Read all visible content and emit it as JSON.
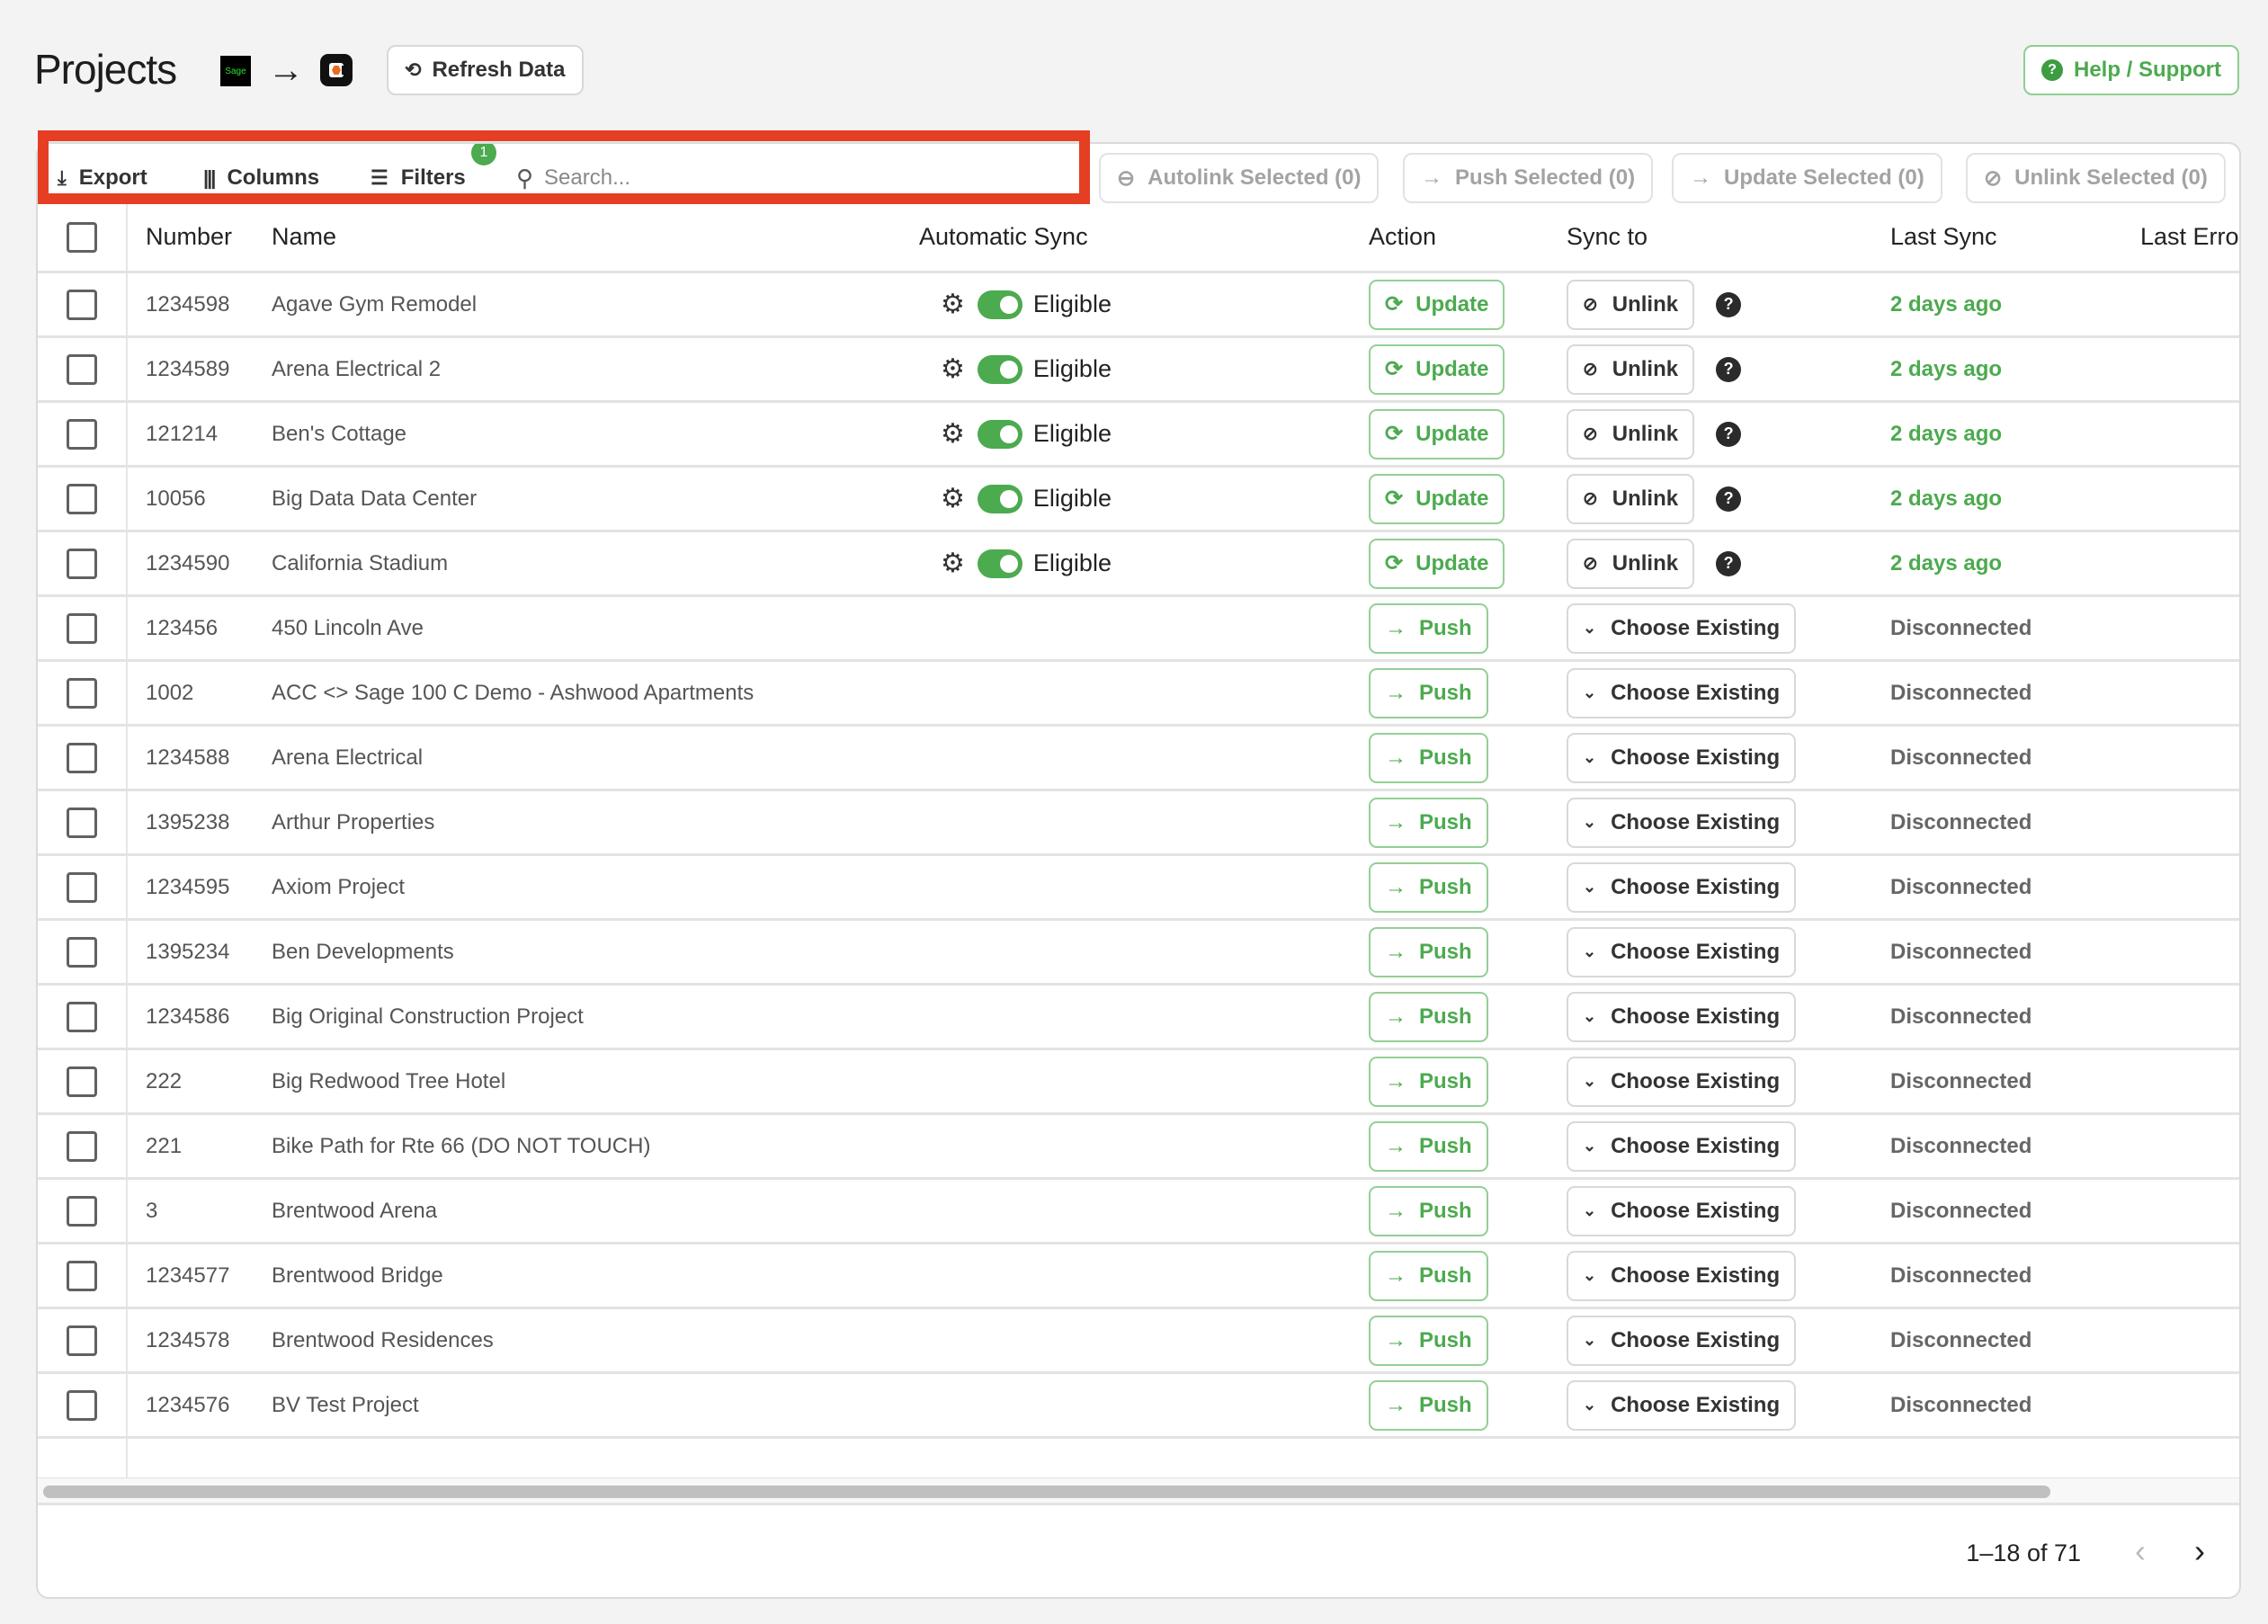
{
  "header": {
    "title": "Projects",
    "source_logo": "Sage",
    "flow_icon": "arrow-right-icon",
    "refresh_label": "Refresh Data",
    "help_label": "Help / Support"
  },
  "toolbar": {
    "export_label": "Export",
    "columns_label": "Columns",
    "filters_label": "Filters",
    "filters_badge": "1",
    "search_placeholder": "Search...",
    "search_value": ""
  },
  "bulk_actions": {
    "autolink": "Autolink Selected (0)",
    "push": "Push Selected (0)",
    "update": "Update Selected (0)",
    "unlink": "Unlink Selected (0)"
  },
  "columns": {
    "number": "Number",
    "name": "Name",
    "auto_sync": "Automatic Sync",
    "action": "Action",
    "sync_to": "Sync to",
    "last_sync": "Last Sync",
    "last_error": "Last Erro"
  },
  "rows": [
    {
      "number": "1234598",
      "name": "Agave Gym Remodel",
      "auto": "Eligible",
      "action": "Update",
      "sync": "Unlink",
      "last": "2 days ago"
    },
    {
      "number": "1234589",
      "name": "Arena Electrical 2",
      "auto": "Eligible",
      "action": "Update",
      "sync": "Unlink",
      "last": "2 days ago"
    },
    {
      "number": "121214",
      "name": "Ben's Cottage",
      "auto": "Eligible",
      "action": "Update",
      "sync": "Unlink",
      "last": "2 days ago"
    },
    {
      "number": "10056",
      "name": "Big Data Data Center",
      "auto": "Eligible",
      "action": "Update",
      "sync": "Unlink",
      "last": "2 days ago"
    },
    {
      "number": "1234590",
      "name": "California Stadium",
      "auto": "Eligible",
      "action": "Update",
      "sync": "Unlink",
      "last": "2 days ago"
    },
    {
      "number": "123456",
      "name": "450 Lincoln Ave",
      "auto": "",
      "action": "Push",
      "sync": "Choose Existing",
      "last": "Disconnected"
    },
    {
      "number": "1002",
      "name": "ACC <> Sage 100 C Demo - Ashwood Apartments",
      "auto": "",
      "action": "Push",
      "sync": "Choose Existing",
      "last": "Disconnected"
    },
    {
      "number": "1234588",
      "name": "Arena Electrical",
      "auto": "",
      "action": "Push",
      "sync": "Choose Existing",
      "last": "Disconnected"
    },
    {
      "number": "1395238",
      "name": "Arthur Properties",
      "auto": "",
      "action": "Push",
      "sync": "Choose Existing",
      "last": "Disconnected"
    },
    {
      "number": "1234595",
      "name": "Axiom Project",
      "auto": "",
      "action": "Push",
      "sync": "Choose Existing",
      "last": "Disconnected"
    },
    {
      "number": "1395234",
      "name": "Ben Developments",
      "auto": "",
      "action": "Push",
      "sync": "Choose Existing",
      "last": "Disconnected"
    },
    {
      "number": "1234586",
      "name": "Big Original Construction Project",
      "auto": "",
      "action": "Push",
      "sync": "Choose Existing",
      "last": "Disconnected"
    },
    {
      "number": "222",
      "name": "Big Redwood Tree Hotel",
      "auto": "",
      "action": "Push",
      "sync": "Choose Existing",
      "last": "Disconnected"
    },
    {
      "number": "221",
      "name": "Bike Path for Rte 66 (DO NOT TOUCH)",
      "auto": "",
      "action": "Push",
      "sync": "Choose Existing",
      "last": "Disconnected"
    },
    {
      "number": "3",
      "name": "Brentwood Arena",
      "auto": "",
      "action": "Push",
      "sync": "Choose Existing",
      "last": "Disconnected"
    },
    {
      "number": "1234577",
      "name": "Brentwood Bridge",
      "auto": "",
      "action": "Push",
      "sync": "Choose Existing",
      "last": "Disconnected"
    },
    {
      "number": "1234578",
      "name": "Brentwood Residences",
      "auto": "",
      "action": "Push",
      "sync": "Choose Existing",
      "last": "Disconnected"
    },
    {
      "number": "1234576",
      "name": "BV Test Project",
      "auto": "",
      "action": "Push",
      "sync": "Choose Existing",
      "last": "Disconnected"
    }
  ],
  "pagination": {
    "range_text": "1–18 of 71"
  },
  "colors": {
    "accent_green": "#4caa4f",
    "highlight_red": "#e53e22"
  }
}
